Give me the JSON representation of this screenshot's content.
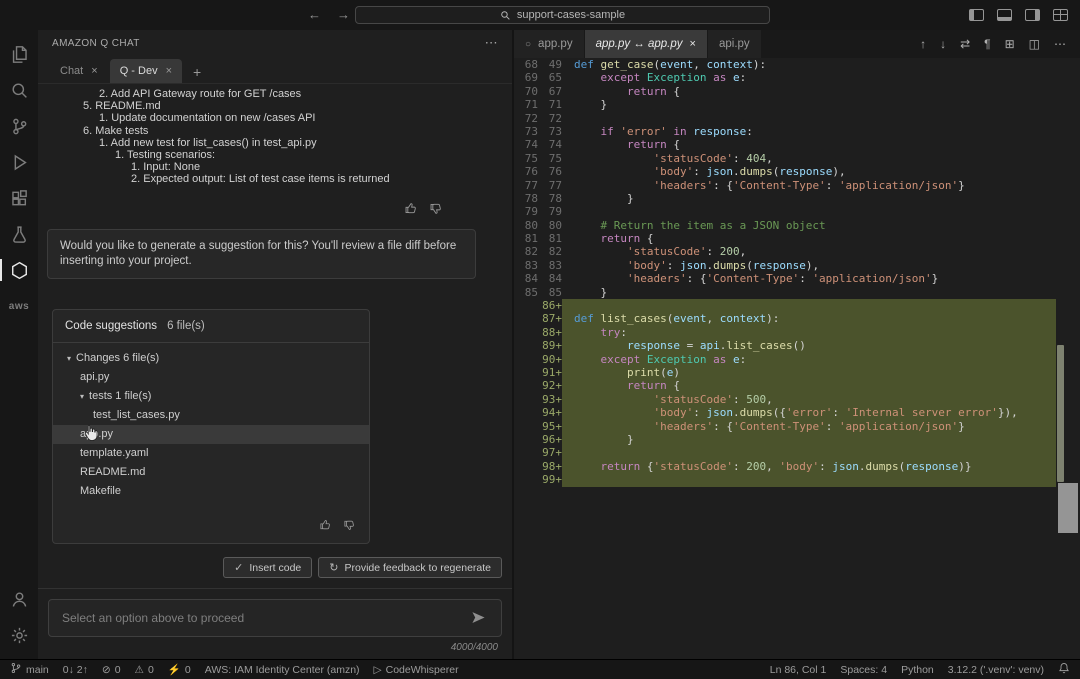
{
  "colors": {
    "diff_added_bg": "#4b532c",
    "keyword_blue": "#569cd6",
    "string_orange": "#ce9178"
  },
  "title_bar": {
    "search_text": "support-cases-sample",
    "window_icons": [
      "toggle-sidebar",
      "toggle-panel",
      "toggle-secondary-sidebar",
      "customize-layout"
    ]
  },
  "activity_bar": {
    "top": [
      {
        "name": "explorer"
      },
      {
        "name": "search"
      },
      {
        "name": "source-control"
      },
      {
        "name": "run-debug"
      },
      {
        "name": "extensions"
      },
      {
        "name": "test-beaker"
      },
      {
        "name": "amazon-q-hexagon",
        "active": true
      },
      {
        "name": "aws-toolkit",
        "label": "aws"
      }
    ],
    "bottom": [
      {
        "name": "account"
      },
      {
        "name": "settings-gear"
      }
    ]
  },
  "chat_panel": {
    "header_title": "AMAZON Q CHAT",
    "tabs": [
      {
        "label": "Chat",
        "active": false
      },
      {
        "label": "Q - Dev",
        "active": true
      }
    ],
    "message_list": {
      "lines": [
        {
          "indent": 2,
          "text": "2. Add API Gateway route for GET /cases"
        },
        {
          "indent": 1,
          "text": "5. README.md"
        },
        {
          "indent": 2,
          "text": "1. Update documentation on new /cases API"
        },
        {
          "indent": 1,
          "text": "6. Make tests"
        },
        {
          "indent": 2,
          "text": "1. Add new test for list_cases() in test_api.py"
        },
        {
          "indent": 3,
          "text": "1. Testing scenarios:"
        },
        {
          "indent": 4,
          "text": "1. Input: None"
        },
        {
          "indent": 4,
          "text": "2. Expected output: List of test case items is returned"
        }
      ]
    },
    "prompt_message": "Would you like to generate a suggestion for this? You'll review a file diff before inserting into your project.",
    "suggestions": {
      "title": "Code suggestions",
      "count": "6 file(s)",
      "items": [
        {
          "depth": 0,
          "chevron": true,
          "label": "Changes 6 file(s)"
        },
        {
          "depth": 1,
          "label": "api.py"
        },
        {
          "depth": 1,
          "chevron": true,
          "label": "tests 1 file(s)"
        },
        {
          "depth": 2,
          "label": "test_list_cases.py"
        },
        {
          "depth": 1,
          "label": "app.py",
          "hover": true
        },
        {
          "depth": 1,
          "label": "template.yaml"
        },
        {
          "depth": 1,
          "label": "README.md"
        },
        {
          "depth": 1,
          "label": "Makefile"
        }
      ]
    },
    "actions": {
      "insert_label": "Insert code",
      "regenerate_label": "Provide feedback to regenerate"
    },
    "input_placeholder": "Select an option above to proceed",
    "char_counter": "4000/4000"
  },
  "editor": {
    "tabs": [
      {
        "label": "app.py",
        "icon": "circle-outline",
        "active": false
      },
      {
        "label": "app.py ↔ app.py",
        "active": true,
        "close": true,
        "italic": true
      },
      {
        "label": "api.py",
        "active": false
      }
    ],
    "tab_actions": [
      "arrow-up",
      "arrow-down",
      "swap",
      "pilcrow",
      "grid",
      "split-editor",
      "more"
    ],
    "lines": [
      {
        "o": "68",
        "n": "49",
        "t": [
          [
            "kw",
            "def "
          ],
          [
            "fn",
            "get_case"
          ],
          [
            "pl",
            "("
          ],
          [
            "var",
            "event"
          ],
          [
            "pl",
            ", "
          ],
          [
            "var",
            "context"
          ],
          [
            "pl",
            "):"
          ]
        ]
      },
      {
        "o": "69",
        "n": "65",
        "t": [
          [
            "pl",
            "    "
          ],
          [
            "ctrl",
            "except "
          ],
          [
            "cls",
            "Exception"
          ],
          [
            "ctrl",
            " as "
          ],
          [
            "var",
            "e"
          ],
          [
            "pl",
            ":"
          ]
        ]
      },
      {
        "o": "70",
        "n": "67",
        "t": [
          [
            "pl",
            "        "
          ],
          [
            "ctrl",
            "return "
          ],
          [
            "pl",
            "{"
          ]
        ]
      },
      {
        "o": "71",
        "n": "71",
        "t": [
          [
            "pl",
            "    }"
          ]
        ]
      },
      {
        "o": "72",
        "n": "72",
        "t": []
      },
      {
        "o": "73",
        "n": "73",
        "t": [
          [
            "pl",
            "    "
          ],
          [
            "ctrl",
            "if "
          ],
          [
            "str",
            "'error'"
          ],
          [
            "ctrl",
            " in "
          ],
          [
            "var",
            "response"
          ],
          [
            "pl",
            ":"
          ]
        ]
      },
      {
        "o": "74",
        "n": "74",
        "t": [
          [
            "pl",
            "        "
          ],
          [
            "ctrl",
            "return "
          ],
          [
            "pl",
            "{"
          ]
        ]
      },
      {
        "o": "75",
        "n": "75",
        "t": [
          [
            "pl",
            "            "
          ],
          [
            "str",
            "'statusCode'"
          ],
          [
            "pl",
            ": "
          ],
          [
            "num",
            "404"
          ],
          [
            "pl",
            ","
          ]
        ]
      },
      {
        "o": "76",
        "n": "76",
        "t": [
          [
            "pl",
            "            "
          ],
          [
            "str",
            "'body'"
          ],
          [
            "pl",
            ": "
          ],
          [
            "var",
            "json"
          ],
          [
            "pl",
            "."
          ],
          [
            "fn",
            "dumps"
          ],
          [
            "pl",
            "("
          ],
          [
            "var",
            "response"
          ],
          [
            "pl",
            "),"
          ]
        ]
      },
      {
        "o": "77",
        "n": "77",
        "t": [
          [
            "pl",
            "            "
          ],
          [
            "str",
            "'headers'"
          ],
          [
            "pl",
            ": {"
          ],
          [
            "str",
            "'Content-Type'"
          ],
          [
            "pl",
            ": "
          ],
          [
            "str",
            "'application/json'"
          ],
          [
            "pl",
            "}"
          ]
        ]
      },
      {
        "o": "78",
        "n": "78",
        "t": [
          [
            "pl",
            "        }"
          ]
        ]
      },
      {
        "o": "79",
        "n": "79",
        "t": []
      },
      {
        "o": "80",
        "n": "80",
        "t": [
          [
            "cmt",
            "    # Return the item as a JSON object"
          ]
        ]
      },
      {
        "o": "81",
        "n": "81",
        "t": [
          [
            "pl",
            "    "
          ],
          [
            "ctrl",
            "return "
          ],
          [
            "pl",
            "{"
          ]
        ]
      },
      {
        "o": "82",
        "n": "82",
        "t": [
          [
            "pl",
            "        "
          ],
          [
            "str",
            "'statusCode'"
          ],
          [
            "pl",
            ": "
          ],
          [
            "num",
            "200"
          ],
          [
            "pl",
            ","
          ]
        ]
      },
      {
        "o": "83",
        "n": "83",
        "t": [
          [
            "pl",
            "        "
          ],
          [
            "str",
            "'body'"
          ],
          [
            "pl",
            ": "
          ],
          [
            "var",
            "json"
          ],
          [
            "pl",
            "."
          ],
          [
            "fn",
            "dumps"
          ],
          [
            "pl",
            "("
          ],
          [
            "var",
            "response"
          ],
          [
            "pl",
            "),"
          ]
        ]
      },
      {
        "o": "84",
        "n": "84",
        "t": [
          [
            "pl",
            "        "
          ],
          [
            "str",
            "'headers'"
          ],
          [
            "pl",
            ": {"
          ],
          [
            "str",
            "'Content-Type'"
          ],
          [
            "pl",
            ": "
          ],
          [
            "str",
            "'application/json'"
          ],
          [
            "pl",
            "}"
          ]
        ]
      },
      {
        "o": "85",
        "n": "85",
        "t": [
          [
            "pl",
            "    }"
          ]
        ]
      },
      {
        "o": "",
        "n": "86+",
        "add": true,
        "t": []
      },
      {
        "o": "",
        "n": "87+",
        "add": true,
        "t": [
          [
            "kw",
            "def "
          ],
          [
            "fn",
            "list_cases"
          ],
          [
            "pl",
            "("
          ],
          [
            "var",
            "event"
          ],
          [
            "pl",
            ", "
          ],
          [
            "var",
            "context"
          ],
          [
            "pl",
            "):"
          ]
        ]
      },
      {
        "o": "",
        "n": "88+",
        "add": true,
        "t": [
          [
            "pl",
            "    "
          ],
          [
            "ctrl",
            "try"
          ],
          [
            "pl",
            ":"
          ]
        ]
      },
      {
        "o": "",
        "n": "89+",
        "add": true,
        "t": [
          [
            "pl",
            "        "
          ],
          [
            "var",
            "response"
          ],
          [
            "pl",
            " = "
          ],
          [
            "var",
            "api"
          ],
          [
            "pl",
            "."
          ],
          [
            "fn",
            "list_cases"
          ],
          [
            "pl",
            "()"
          ]
        ]
      },
      {
        "o": "",
        "n": "90+",
        "add": true,
        "t": [
          [
            "pl",
            "    "
          ],
          [
            "ctrl",
            "except "
          ],
          [
            "cls",
            "Exception"
          ],
          [
            "ctrl",
            " as "
          ],
          [
            "var",
            "e"
          ],
          [
            "pl",
            ":"
          ]
        ]
      },
      {
        "o": "",
        "n": "91+",
        "add": true,
        "t": [
          [
            "pl",
            "        "
          ],
          [
            "fn",
            "print"
          ],
          [
            "pl",
            "("
          ],
          [
            "var",
            "e"
          ],
          [
            "pl",
            ")"
          ]
        ]
      },
      {
        "o": "",
        "n": "92+",
        "add": true,
        "t": [
          [
            "pl",
            "        "
          ],
          [
            "ctrl",
            "return "
          ],
          [
            "pl",
            "{"
          ]
        ]
      },
      {
        "o": "",
        "n": "93+",
        "add": true,
        "t": [
          [
            "pl",
            "            "
          ],
          [
            "str",
            "'statusCode'"
          ],
          [
            "pl",
            ": "
          ],
          [
            "num",
            "500"
          ],
          [
            "pl",
            ","
          ]
        ]
      },
      {
        "o": "",
        "n": "94+",
        "add": true,
        "t": [
          [
            "pl",
            "            "
          ],
          [
            "str",
            "'body'"
          ],
          [
            "pl",
            ": "
          ],
          [
            "var",
            "json"
          ],
          [
            "pl",
            "."
          ],
          [
            "fn",
            "dumps"
          ],
          [
            "pl",
            "({"
          ],
          [
            "str",
            "'error'"
          ],
          [
            "pl",
            ": "
          ],
          [
            "str",
            "'Internal server error'"
          ],
          [
            "pl",
            "}),"
          ]
        ]
      },
      {
        "o": "",
        "n": "95+",
        "add": true,
        "t": [
          [
            "pl",
            "            "
          ],
          [
            "str",
            "'headers'"
          ],
          [
            "pl",
            ": {"
          ],
          [
            "str",
            "'Content-Type'"
          ],
          [
            "pl",
            ": "
          ],
          [
            "str",
            "'application/json'"
          ],
          [
            "pl",
            "}"
          ]
        ]
      },
      {
        "o": "",
        "n": "96+",
        "add": true,
        "t": [
          [
            "pl",
            "        }"
          ]
        ]
      },
      {
        "o": "",
        "n": "97+",
        "add": true,
        "t": []
      },
      {
        "o": "",
        "n": "98+",
        "add": true,
        "t": [
          [
            "pl",
            "    "
          ],
          [
            "ctrl",
            "return "
          ],
          [
            "pl",
            "{"
          ],
          [
            "str",
            "'statusCode'"
          ],
          [
            "pl",
            ": "
          ],
          [
            "num",
            "200"
          ],
          [
            "pl",
            ", "
          ],
          [
            "str",
            "'body'"
          ],
          [
            "pl",
            ": "
          ],
          [
            "var",
            "json"
          ],
          [
            "pl",
            "."
          ],
          [
            "fn",
            "dumps"
          ],
          [
            "pl",
            "("
          ],
          [
            "var",
            "response"
          ],
          [
            "pl",
            ")}"
          ]
        ]
      },
      {
        "o": "",
        "n": "99+",
        "add": true,
        "t": []
      }
    ]
  },
  "status_bar": {
    "left": [
      {
        "icon": "git-branch",
        "text": "main"
      },
      {
        "text": "0↓ 2↑"
      },
      {
        "icon": "error-circle",
        "text": "0"
      },
      {
        "icon": "warning-triangle",
        "text": "0"
      },
      {
        "icon": "zap",
        "text": "0"
      },
      {
        "text": "AWS: IAM Identity Center (amzn)"
      },
      {
        "icon": "play",
        "text": "CodeWhisperer"
      }
    ],
    "right": [
      {
        "text": "Ln 86, Col 1"
      },
      {
        "text": "Spaces: 4"
      },
      {
        "text": "Python"
      },
      {
        "text": "3.12.2 ('.venv': venv)"
      },
      {
        "icon": "bell",
        "text": ""
      }
    ]
  }
}
